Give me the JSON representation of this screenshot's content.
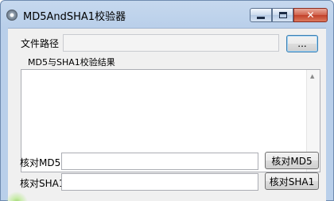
{
  "window": {
    "title": "MD5AndSHA1校验器",
    "icon": "gear-icon",
    "controls": {
      "minimize": "minimize-icon",
      "maximize": "maximize-icon",
      "close_label": "✕"
    }
  },
  "file": {
    "label": "文件路径",
    "value": "",
    "browse_label": "..."
  },
  "result": {
    "group_label": "MD5与SHA1校验结果",
    "value": ""
  },
  "md5": {
    "label": "核对MD5",
    "value": "",
    "button_label": "核对MD5"
  },
  "sha1": {
    "label": "核对SHA1",
    "value": "",
    "button_label": "核对SHA1"
  },
  "colors": {
    "titlebar": "#c6d8ee",
    "client": "#f0f0f0",
    "close": "#c1412a"
  }
}
